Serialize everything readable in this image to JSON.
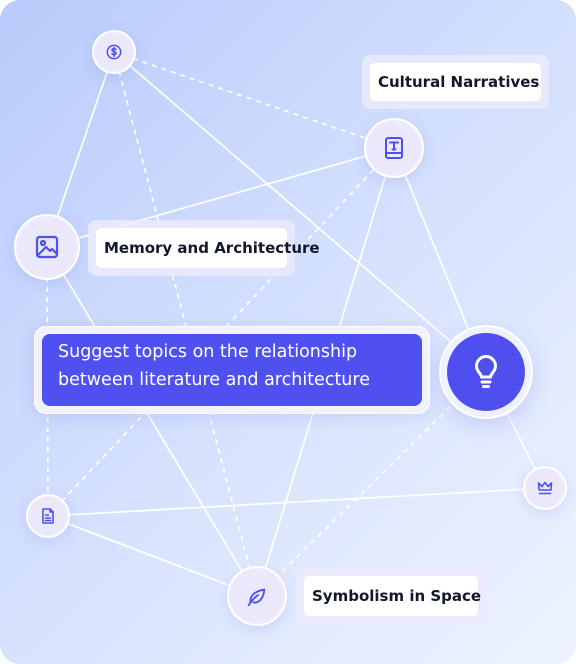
{
  "prompt": {
    "line1": "Suggest topics on the relationship",
    "line2": "between literature and architecture"
  },
  "labels": {
    "cultural": "Cultural Narratives",
    "memory": "Memory and Architecture",
    "symbolism": "Symbolism in Space"
  },
  "nodes": [
    {
      "id": "dollar",
      "icon": "dollar-icon"
    },
    {
      "id": "book",
      "icon": "book-icon"
    },
    {
      "id": "image",
      "icon": "image-icon"
    },
    {
      "id": "bulb",
      "icon": "lightbulb-icon"
    },
    {
      "id": "crown",
      "icon": "crown-icon"
    },
    {
      "id": "doc",
      "icon": "document-icon"
    },
    {
      "id": "leaf",
      "icon": "leaf-icon"
    }
  ],
  "edges": [
    {
      "from": "dollar",
      "to": "image",
      "style": "solid"
    },
    {
      "from": "dollar",
      "to": "bulb",
      "style": "solid"
    },
    {
      "from": "dollar",
      "to": "book",
      "style": "dashed"
    },
    {
      "from": "dollar",
      "to": "leaf",
      "style": "dashed"
    },
    {
      "from": "book",
      "to": "image",
      "style": "solid"
    },
    {
      "from": "book",
      "to": "leaf",
      "style": "solid"
    },
    {
      "from": "book",
      "to": "bulb",
      "style": "solid"
    },
    {
      "from": "book",
      "to": "doc",
      "style": "dashed"
    },
    {
      "from": "image",
      "to": "leaf",
      "style": "solid"
    },
    {
      "from": "image",
      "to": "doc",
      "style": "dashed"
    },
    {
      "from": "doc",
      "to": "leaf",
      "style": "solid"
    },
    {
      "from": "doc",
      "to": "crown",
      "style": "solid"
    },
    {
      "from": "bulb",
      "to": "crown",
      "style": "solid"
    },
    {
      "from": "bulb",
      "to": "leaf",
      "style": "dashed"
    }
  ],
  "colors": {
    "accent": "#4f50f0",
    "icon": "#4f50f0",
    "edge": "#ffffff",
    "label_text": "#111827"
  }
}
